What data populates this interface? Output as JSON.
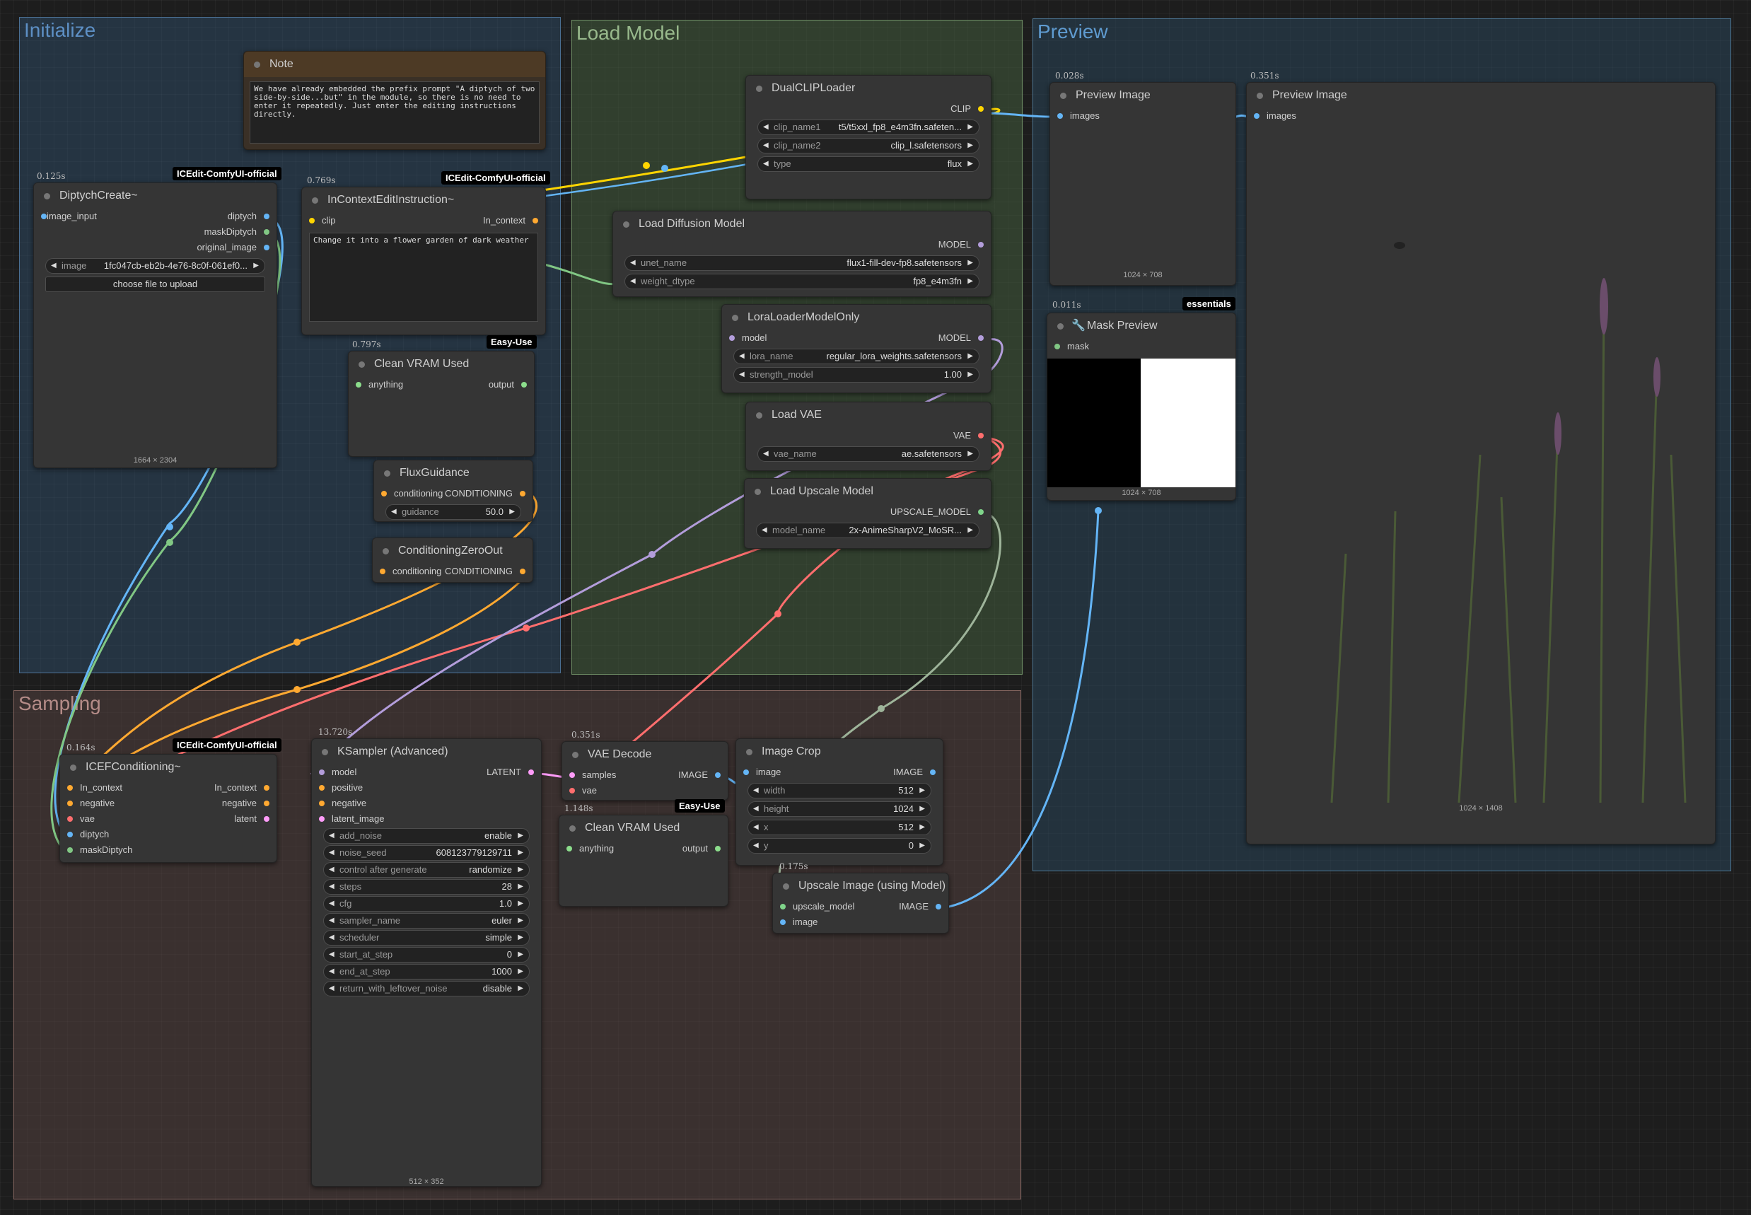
{
  "groups": {
    "initialize": "Initialize",
    "load_model": "Load Model",
    "preview": "Preview",
    "sampling": "Sampling"
  },
  "colors": {
    "image": "#64b5f6",
    "mask": "#81c784",
    "clip": "#ffd500",
    "conditioning": "#ffa931",
    "model": "#b39ddb",
    "vae": "#ff6e6e",
    "latent": "#ff9cf9",
    "upscale_model": "#7fd48a"
  },
  "note": {
    "title": "Note",
    "text": "We have already embedded the prefix prompt \"A diptych of two side-by-side...but\" in the module, so there is no need to enter it repeatedly. Just enter the editing instructions directly."
  },
  "diptych_create": {
    "time": "0.125s",
    "badge": "ICEdit-ComfyUI-official",
    "title": "DiptychCreate~",
    "input_image": "image_input",
    "outputs": [
      "diptych",
      "maskDiptych",
      "original_image"
    ],
    "image_label": "image",
    "image_value": "1fc047cb-eb2b-4e76-8c0f-061ef0...",
    "upload_button": "choose file to upload",
    "image_size": "1664 × 2304"
  },
  "incontext_edit": {
    "time": "0.769s",
    "badge": "ICEdit-ComfyUI-official",
    "title": "InContextEditInstruction~",
    "input_clip": "clip",
    "output": "In_context",
    "prompt": "Change it into a flower garden of dark weather"
  },
  "clean_vram_1": {
    "time": "0.797s",
    "badge": "Easy-Use",
    "title": "Clean VRAM Used",
    "input": "anything",
    "output": "output"
  },
  "flux_guidance": {
    "title": "FluxGuidance",
    "input": "conditioning",
    "output": "CONDITIONING",
    "widget_label": "guidance",
    "widget_value": "50.0"
  },
  "conditioning_zero": {
    "title": "ConditioningZeroOut",
    "input": "conditioning",
    "output": "CONDITIONING"
  },
  "dual_clip": {
    "title": "DualCLIPLoader",
    "output": "CLIP",
    "widgets": [
      {
        "label": "clip_name1",
        "value": "t5/t5xxl_fp8_e4m3fn.safeten..."
      },
      {
        "label": "clip_name2",
        "value": "clip_l.safetensors"
      },
      {
        "label": "type",
        "value": "flux"
      }
    ]
  },
  "load_diffusion": {
    "title": "Load Diffusion Model",
    "output": "MODEL",
    "widgets": [
      {
        "label": "unet_name",
        "value": "flux1-fill-dev-fp8.safetensors"
      },
      {
        "label": "weight_dtype",
        "value": "fp8_e4m3fn"
      }
    ]
  },
  "lora_loader": {
    "title": "LoraLoaderModelOnly",
    "input": "model",
    "output": "MODEL",
    "widgets": [
      {
        "label": "lora_name",
        "value": "regular_lora_weights.safetensors"
      },
      {
        "label": "strength_model",
        "value": "1.00"
      }
    ]
  },
  "load_vae": {
    "title": "Load VAE",
    "output": "VAE",
    "widget_label": "vae_name",
    "widget_value": "ae.safetensors"
  },
  "load_upscale": {
    "title": "Load Upscale Model",
    "output": "UPSCALE_MODEL",
    "widget_label": "model_name",
    "widget_value": "2x-AnimeSharpV2_MoSR..."
  },
  "preview_small": {
    "time": "0.028s",
    "title": "Preview Image",
    "input": "images",
    "image_size": "1024 × 708"
  },
  "mask_preview": {
    "time": "0.011s",
    "badge": "essentials",
    "title": "Mask Preview",
    "input": "mask",
    "image_size": "1024 × 708"
  },
  "preview_large": {
    "time": "0.351s",
    "title": "Preview Image",
    "input": "images",
    "image_size": "1024 × 1408"
  },
  "icef_cond": {
    "time": "0.164s",
    "badge": "ICEdit-ComfyUI-official",
    "title": "ICEFConditioning~",
    "inputs": [
      "In_context",
      "negative",
      "vae",
      "diptych",
      "maskDiptych"
    ],
    "outputs": [
      "In_context",
      "negative",
      "latent"
    ]
  },
  "ksampler": {
    "time": "13.720s",
    "title": "KSampler (Advanced)",
    "inputs": [
      "model",
      "positive",
      "negative",
      "latent_image"
    ],
    "output": "LATENT",
    "widgets": [
      {
        "label": "add_noise",
        "value": "enable"
      },
      {
        "label": "noise_seed",
        "value": "608123779129711"
      },
      {
        "label": "control after generate",
        "value": "randomize"
      },
      {
        "label": "steps",
        "value": "28"
      },
      {
        "label": "cfg",
        "value": "1.0"
      },
      {
        "label": "sampler_name",
        "value": "euler"
      },
      {
        "label": "scheduler",
        "value": "simple"
      },
      {
        "label": "start_at_step",
        "value": "0"
      },
      {
        "label": "end_at_step",
        "value": "1000"
      },
      {
        "label": "return_with_leftover_noise",
        "value": "disable"
      }
    ],
    "image_size": "512 × 352"
  },
  "vae_decode": {
    "time": "0.351s",
    "title": "VAE Decode",
    "inputs": [
      "samples",
      "vae"
    ],
    "output": "IMAGE"
  },
  "clean_vram_2": {
    "time": "1.148s",
    "badge": "Easy-Use",
    "title": "Clean VRAM Used",
    "input": "anything",
    "output": "output"
  },
  "image_crop": {
    "title": "Image Crop",
    "input": "image",
    "output": "IMAGE",
    "widgets": [
      {
        "label": "width",
        "value": "512"
      },
      {
        "label": "height",
        "value": "1024"
      },
      {
        "label": "x",
        "value": "512"
      },
      {
        "label": "y",
        "value": "0"
      }
    ]
  },
  "upscale_image": {
    "time": "0.175s",
    "title": "Upscale Image (using Model)",
    "inputs": [
      "upscale_model",
      "image"
    ],
    "output": "IMAGE"
  }
}
